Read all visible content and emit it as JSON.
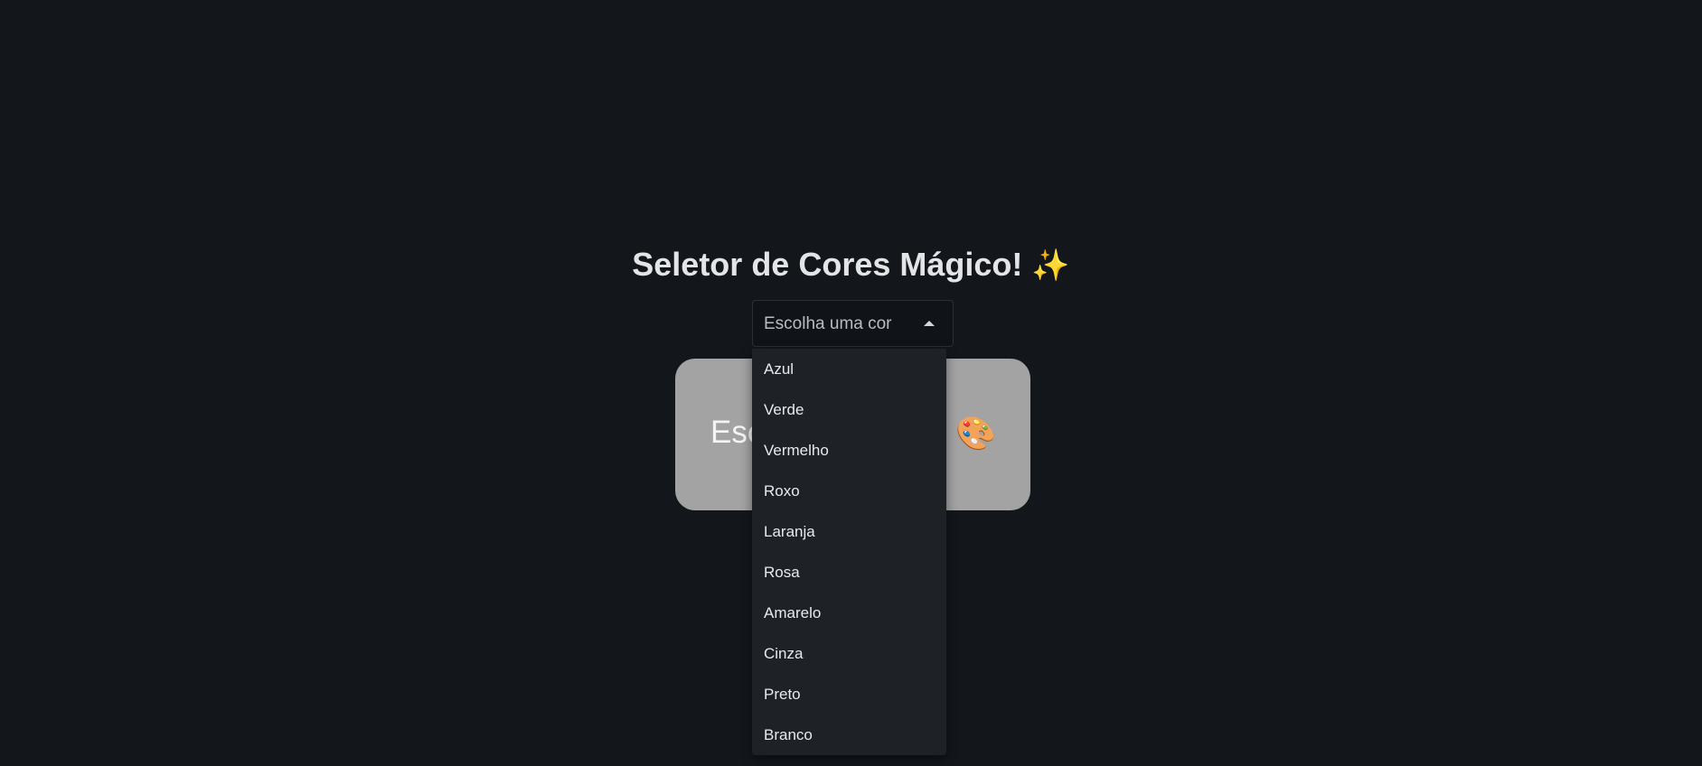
{
  "header": {
    "title": "Seletor de Cores Mágico!",
    "title_emoji": "✨"
  },
  "color_select": {
    "placeholder": "Escolha uma cor",
    "expanded": true,
    "options": [
      "Azul",
      "Verde",
      "Vermelho",
      "Roxo",
      "Laranja",
      "Rosa",
      "Amarelo",
      "Cinza",
      "Preto",
      "Branco"
    ]
  },
  "preview_card": {
    "text": "Esc",
    "emoji": "🎨",
    "background_color": "#a3a3a3"
  },
  "colors": {
    "page_background": "#13161b",
    "menu_background": "#1e2126"
  }
}
